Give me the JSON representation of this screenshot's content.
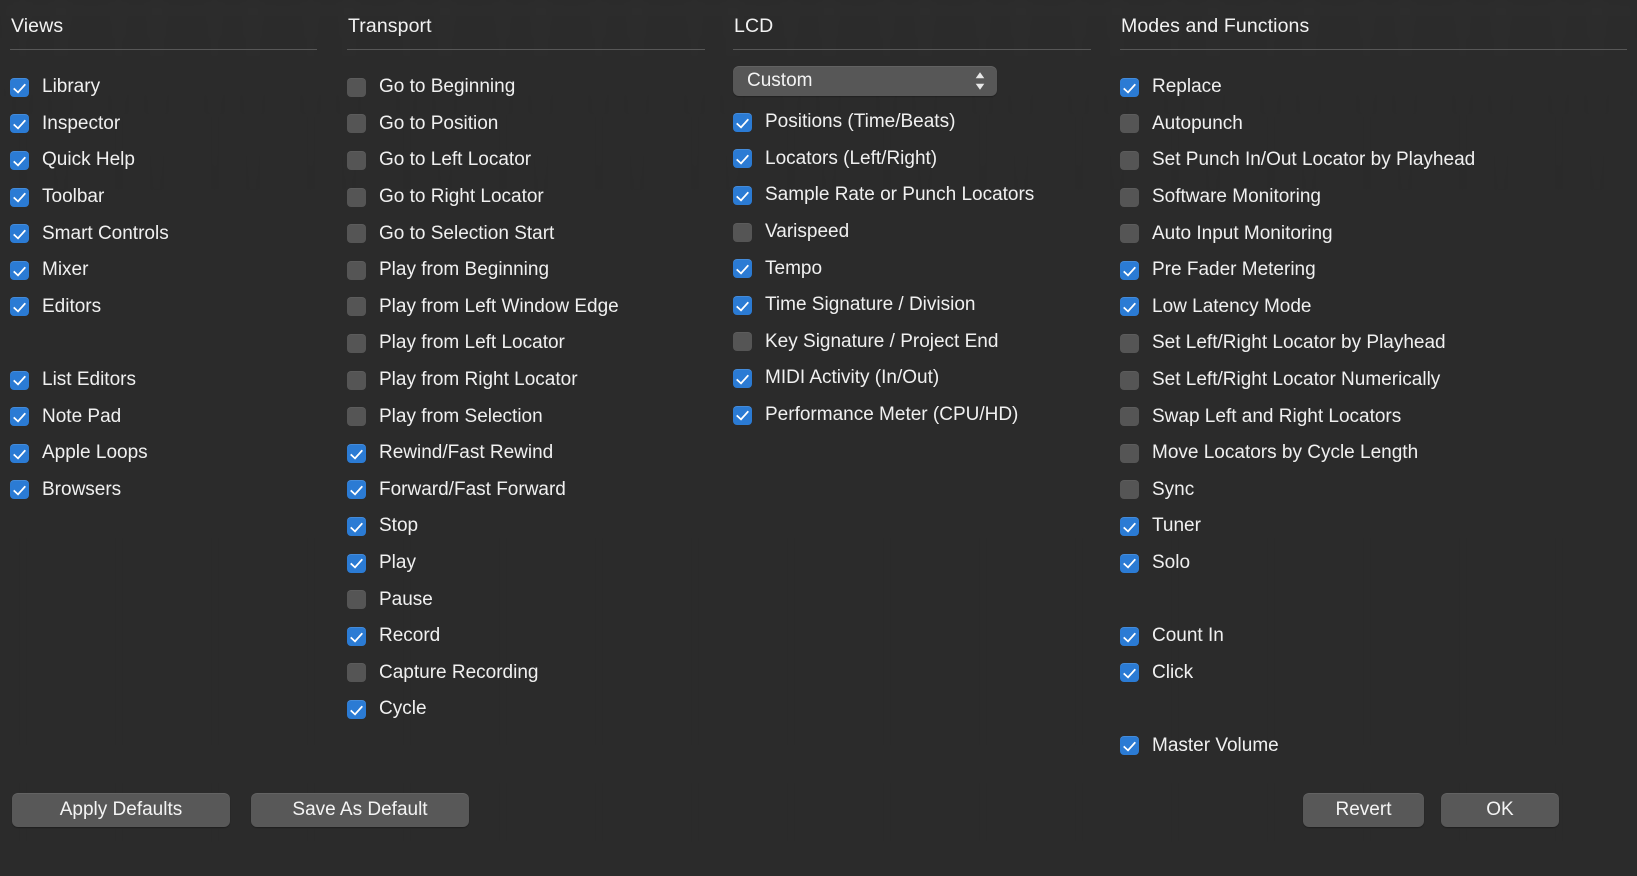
{
  "colors": {
    "background": "#2b2b2b",
    "checkbox_on": "#2b7bd4",
    "checkbox_off": "#555555",
    "button": "#585858",
    "text": "#f0f0f0",
    "rule": "#575757"
  },
  "columns": [
    {
      "title": "Views",
      "items": [
        {
          "label": "Library",
          "checked": true
        },
        {
          "label": "Inspector",
          "checked": true
        },
        {
          "label": "Quick Help",
          "checked": true
        },
        {
          "label": "Toolbar",
          "checked": true
        },
        {
          "label": "Smart Controls",
          "checked": true
        },
        {
          "label": "Mixer",
          "checked": true
        },
        {
          "label": "Editors",
          "checked": true
        },
        {
          "spacer": true
        },
        {
          "label": "List Editors",
          "checked": true
        },
        {
          "label": "Note Pad",
          "checked": true
        },
        {
          "label": "Apple Loops",
          "checked": true
        },
        {
          "label": "Browsers",
          "checked": true
        }
      ]
    },
    {
      "title": "Transport",
      "items": [
        {
          "label": "Go to Beginning",
          "checked": false
        },
        {
          "label": "Go to Position",
          "checked": false
        },
        {
          "label": "Go to Left Locator",
          "checked": false
        },
        {
          "label": "Go to Right Locator",
          "checked": false
        },
        {
          "label": "Go to Selection Start",
          "checked": false
        },
        {
          "label": "Play from Beginning",
          "checked": false
        },
        {
          "label": "Play from Left Window Edge",
          "checked": false
        },
        {
          "label": "Play from Left Locator",
          "checked": false
        },
        {
          "label": "Play from Right Locator",
          "checked": false
        },
        {
          "label": "Play from Selection",
          "checked": false
        },
        {
          "label": "Rewind/Fast Rewind",
          "checked": true
        },
        {
          "label": "Forward/Fast Forward",
          "checked": true
        },
        {
          "label": "Stop",
          "checked": true
        },
        {
          "label": "Play",
          "checked": true
        },
        {
          "label": "Pause",
          "checked": false
        },
        {
          "label": "Record",
          "checked": true
        },
        {
          "label": "Capture Recording",
          "checked": false
        },
        {
          "label": "Cycle",
          "checked": true
        }
      ]
    },
    {
      "title": "LCD",
      "popup": {
        "value": "Custom",
        "icon": "stepper-updown-icon"
      },
      "items": [
        {
          "label": "Positions (Time/Beats)",
          "checked": true
        },
        {
          "label": "Locators (Left/Right)",
          "checked": true
        },
        {
          "label": "Sample Rate or Punch Locators",
          "checked": true
        },
        {
          "label": "Varispeed",
          "checked": false
        },
        {
          "label": "Tempo",
          "checked": true
        },
        {
          "label": "Time Signature / Division",
          "checked": true
        },
        {
          "label": "Key Signature / Project End",
          "checked": false
        },
        {
          "label": "MIDI Activity (In/Out)",
          "checked": true
        },
        {
          "label": "Performance Meter (CPU/HD)",
          "checked": true
        }
      ]
    },
    {
      "title": "Modes and Functions",
      "items": [
        {
          "label": "Replace",
          "checked": true
        },
        {
          "label": "Autopunch",
          "checked": false
        },
        {
          "label": "Set Punch In/Out Locator by Playhead",
          "checked": false
        },
        {
          "label": "Software Monitoring",
          "checked": false
        },
        {
          "label": "Auto Input Monitoring",
          "checked": false
        },
        {
          "label": "Pre Fader Metering",
          "checked": true
        },
        {
          "label": "Low Latency Mode",
          "checked": true
        },
        {
          "label": "Set Left/Right Locator by Playhead",
          "checked": false
        },
        {
          "label": "Set Left/Right Locator Numerically",
          "checked": false
        },
        {
          "label": "Swap Left and Right Locators",
          "checked": false
        },
        {
          "label": "Move Locators by Cycle Length",
          "checked": false
        },
        {
          "label": "Sync",
          "checked": false
        },
        {
          "label": "Tuner",
          "checked": true
        },
        {
          "label": "Solo",
          "checked": true
        },
        {
          "spacer": true
        },
        {
          "label": "Count In",
          "checked": true
        },
        {
          "label": "Click",
          "checked": true
        },
        {
          "spacer": true
        },
        {
          "label": "Master Volume",
          "checked": true
        }
      ]
    }
  ],
  "buttons": {
    "apply_defaults": "Apply Defaults",
    "save_as_default": "Save As Default",
    "revert": "Revert",
    "ok": "OK"
  }
}
